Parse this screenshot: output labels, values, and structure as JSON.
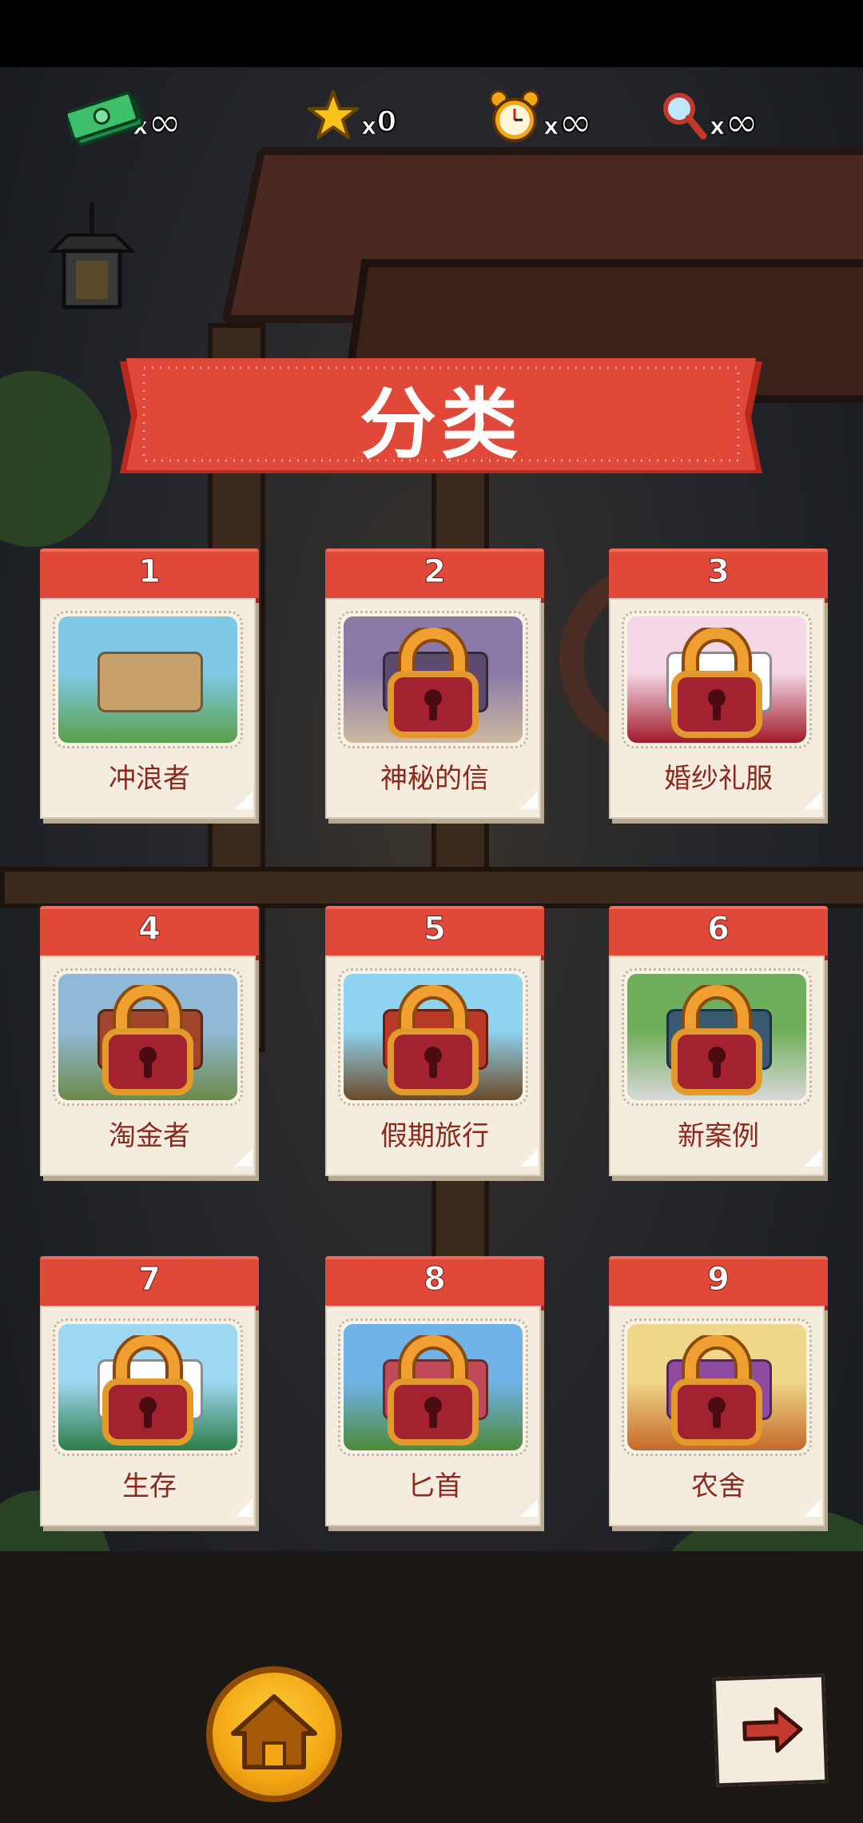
{
  "resources": [
    {
      "icon": "cash-icon",
      "x": "x",
      "value": "∞"
    },
    {
      "icon": "star-icon",
      "x": "x",
      "value": "0"
    },
    {
      "icon": "alarm-clock-icon",
      "x": "x",
      "value": "∞"
    },
    {
      "icon": "magnifier-icon",
      "x": "x",
      "value": "∞"
    }
  ],
  "title": "分类",
  "categories": [
    {
      "number": "1",
      "label": "冲浪者",
      "locked": false
    },
    {
      "number": "2",
      "label": "神秘的信",
      "locked": true
    },
    {
      "number": "3",
      "label": "婚纱礼服",
      "locked": true
    },
    {
      "number": "4",
      "label": "淘金者",
      "locked": true
    },
    {
      "number": "5",
      "label": "假期旅行",
      "locked": true
    },
    {
      "number": "6",
      "label": "新案例",
      "locked": true
    },
    {
      "number": "7",
      "label": "生存",
      "locked": true
    },
    {
      "number": "8",
      "label": "匕首",
      "locked": true
    },
    {
      "number": "9",
      "label": "农舍",
      "locked": true
    }
  ],
  "buttons": {
    "home": "home-icon",
    "next": "arrow-right-icon"
  },
  "colors": {
    "banner": "#e0483a",
    "card": "#f4ecdf",
    "label": "#8a2a1c",
    "home": "#f3a714"
  }
}
